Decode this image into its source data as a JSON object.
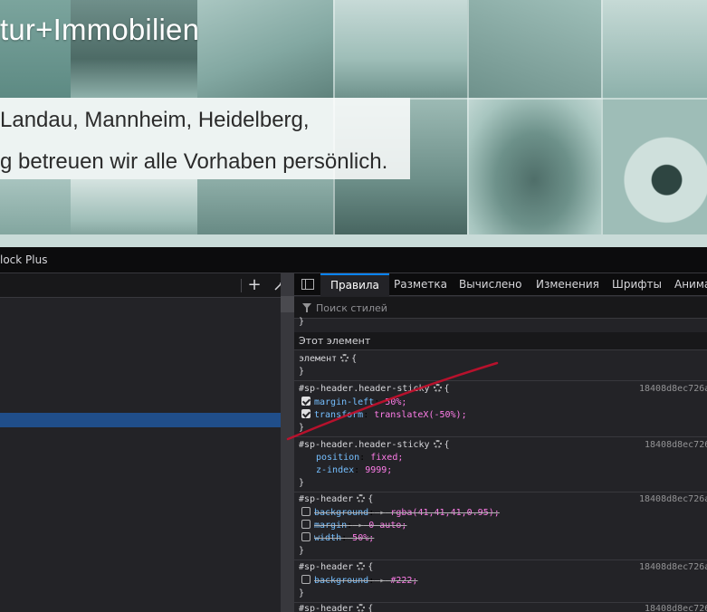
{
  "hero": {
    "title": "tur+Immobilien",
    "line1": "Landau, Mannheim, Heidelberg,",
    "line2": "g betreuen wir alle Vorhaben persönlich."
  },
  "devtools": {
    "title_fragment": "lock Plus",
    "toolbar": {
      "add_node_icon": "+",
      "eyedropper_icon": "eyedropper"
    },
    "tabs": [
      {
        "label": "Правила",
        "active": true
      },
      {
        "label": "Разметка"
      },
      {
        "label": "Вычислено"
      },
      {
        "label": "Изменения"
      },
      {
        "label": "Шрифты"
      },
      {
        "label": "Анима"
      }
    ],
    "filter_placeholder": "Поиск стилей",
    "section_header": "Этот элемент",
    "element_rule": {
      "selector": "элемент",
      "open": "{",
      "close": "}"
    },
    "rules": [
      {
        "selector": "#sp-header.header-sticky",
        "source": "18408d8ec726a",
        "decls": [
          {
            "prop": "margin-left",
            "val": "50%;",
            "checked": true
          },
          {
            "prop": "transform",
            "val": "translateX(-50%);",
            "checked": true
          }
        ]
      },
      {
        "selector": "#sp-header.header-sticky",
        "source": "18408d8ec726",
        "decls": [
          {
            "prop": "position",
            "val": "fixed;"
          },
          {
            "prop": "z-index",
            "val": "9999;"
          }
        ]
      },
      {
        "selector": "#sp-header",
        "source": "18408d8ec726a",
        "decls": [
          {
            "prop": "background",
            "val": "rgba(41,41,41,0.95);",
            "checked": false
          },
          {
            "prop": "margin",
            "val": "0 auto;",
            "checked": false
          },
          {
            "prop": "width",
            "val": "50%;",
            "checked": false
          }
        ]
      },
      {
        "selector": "#sp-header",
        "source": "18408d8ec726a",
        "decls": [
          {
            "prop": "background",
            "val": "#222;",
            "checked": false
          }
        ]
      },
      {
        "selector": "#sp-header",
        "source": "18408d8ec726"
      }
    ],
    "brace_open": "{",
    "brace_close": "}",
    "colon": ":",
    "arrow": "▸"
  },
  "colors": {
    "devtools_bg": "#232327",
    "toolbar_bg": "#0c0c0d",
    "selected_row": "#204e8a",
    "active_tab": "#0a84ff",
    "property": "#75bfff",
    "value": "#ff7de9",
    "annotation_stroke": "#c8102e"
  }
}
